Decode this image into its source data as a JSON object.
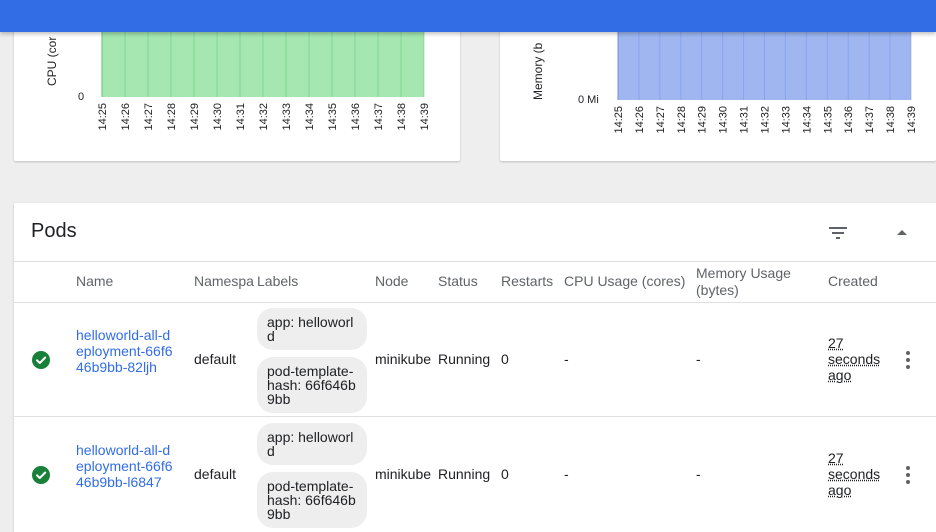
{
  "colors": {
    "topbar": "#326de6",
    "cpu_fill": "#a5e6b1",
    "cpu_stroke": "#5cc46f",
    "mem_fill": "#9fb6f1",
    "mem_stroke": "#6f90e8",
    "link": "#326de6",
    "success": "#188038"
  },
  "cpu_chart": {
    "ylabel": "CPU (cor",
    "zero_label": "0",
    "ticks": [
      "14:25",
      "14:26",
      "14:27",
      "14:28",
      "14:29",
      "14:30",
      "14:31",
      "14:32",
      "14:33",
      "14:34",
      "14:35",
      "14:36",
      "14:37",
      "14:38",
      "14:39"
    ]
  },
  "memory_chart": {
    "ylabel": "Memory (b",
    "zero_label": "0 Mi",
    "ticks": [
      "14:25",
      "14:26",
      "14:27",
      "14:28",
      "14:29",
      "14:30",
      "14:31",
      "14:32",
      "14:33",
      "14:34",
      "14:35",
      "14:36",
      "14:37",
      "14:38",
      "14:39"
    ]
  },
  "pods": {
    "title": "Pods",
    "filter_icon": "filter-list-icon",
    "collapse_icon": "arrow-drop-up-icon",
    "columns": {
      "name": "Name",
      "namespace": "Namespa",
      "labels": "Labels",
      "node": "Node",
      "status": "Status",
      "restarts": "Restarts",
      "cpu": "CPU Usage (cores)",
      "memory_line1": "Memory Usage",
      "memory_line2": "(bytes)",
      "created": "Created"
    },
    "rows": [
      {
        "status_icon": "check-circle-icon",
        "name": "helloworld-all-deployment-66f646b9bb-82ljh",
        "namespace": "default",
        "label1": "app: helloworld",
        "label2": "pod-template-hash: 66f646b9bb",
        "node": "minikube",
        "status": "Running",
        "restarts": "0",
        "cpu": "-",
        "memory": "-",
        "created": "27 seconds ago"
      },
      {
        "status_icon": "check-circle-icon",
        "name": "helloworld-all-deployment-66f646b9bb-l6847",
        "namespace": "default",
        "label1": "app: helloworld",
        "label2": "pod-template-hash: 66f646b9bb",
        "node": "minikube",
        "status": "Running",
        "restarts": "0",
        "cpu": "-",
        "memory": "-",
        "created": "27 seconds ago"
      }
    ]
  }
}
